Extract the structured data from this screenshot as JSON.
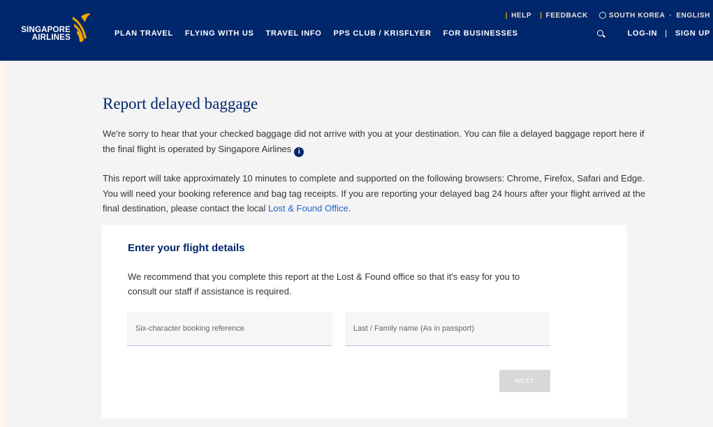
{
  "brand": {
    "line1": "SINGAPORE",
    "line2": "AIRLINES",
    "gold": "#f0a500",
    "navy": "#00266b"
  },
  "utility": {
    "help": "HELP",
    "feedback": "FEEDBACK",
    "country": "SOUTH KOREA",
    "language": "ENGLISH"
  },
  "nav": [
    "PLAN TRAVEL",
    "FLYING WITH US",
    "TRAVEL INFO",
    "PPS CLUB / KRISFLYER",
    "FOR BUSINESSES"
  ],
  "account": {
    "login": "LOG-IN",
    "divider": "|",
    "signup": "SIGN UP"
  },
  "page": {
    "title": "Report delayed baggage",
    "intro": "We're sorry to hear that your checked baggage did not arrive with you at your destination. You can file a delayed baggage report here if the final flight is operated by Singapore Airlines",
    "info_icon": "i",
    "details": "This report will take approximately 10 minutes to complete and supported on the following browsers: Chrome, Firefox, Safari and Edge. You will need your booking reference and bag tag receipts. If you are reporting your delayed bag 24 hours after your flight arrived at the final destination, please contact the local",
    "link": "Lost & Found Office",
    "link_suffix": "."
  },
  "form": {
    "title": "Enter your flight details",
    "description": "We recommend that you complete this report at the Lost & Found office so that it's easy for you to consult our staff if assistance is required.",
    "booking_placeholder": "Six-character booking reference",
    "lastname_placeholder": "Last / Family name (As in passport)",
    "next_label": "NEXT"
  }
}
